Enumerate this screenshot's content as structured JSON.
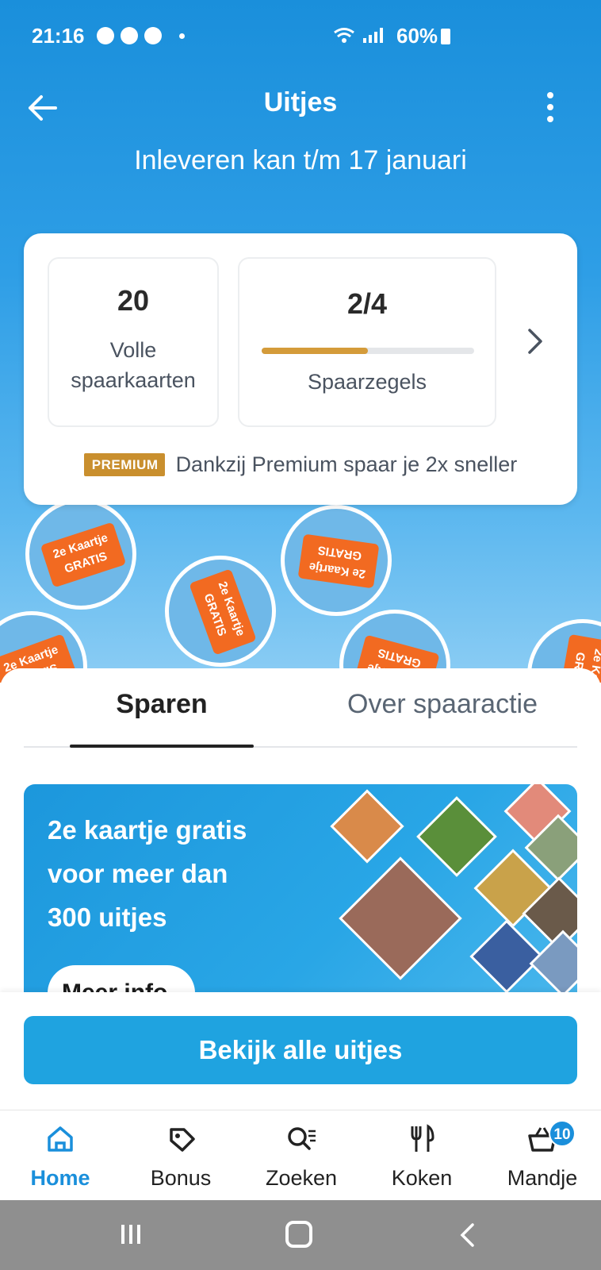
{
  "status_bar": {
    "time": "21:16",
    "battery": "60%"
  },
  "header": {
    "title": "Uitjes",
    "subtitle": "Inleveren kan t/m 17 januari"
  },
  "summary": {
    "full_cards_count": "20",
    "full_cards_label_line1": "Volle",
    "full_cards_label_line2": "spaarkaarten",
    "stamps_count": "2/4",
    "stamps_progress": 0.5,
    "stamps_label": "Spaarzegels",
    "premium_badge": "PREMIUM",
    "premium_text": "Dankzij Premium spaar je 2x sneller"
  },
  "stamps_art": {
    "ticket_text_line1": "2e Kaartje",
    "ticket_text_line2": "GRATIS"
  },
  "tabs": {
    "active": "Sparen",
    "inactive": "Over spaaractie"
  },
  "promo": {
    "line1": "2e kaartje gratis",
    "line2": "voor meer dan",
    "line3": "300 uitjes",
    "button": "Meer info"
  },
  "cta": {
    "label": "Bekijk alle uitjes"
  },
  "bottom_nav": {
    "items": [
      {
        "label": "Home",
        "icon": "home-icon"
      },
      {
        "label": "Bonus",
        "icon": "tag-icon"
      },
      {
        "label": "Zoeken",
        "icon": "search-list-icon"
      },
      {
        "label": "Koken",
        "icon": "cutlery-icon"
      },
      {
        "label": "Mandje",
        "icon": "basket-icon"
      }
    ],
    "basket_badge": "10"
  },
  "colors": {
    "brand": "#1a8fdb",
    "premium": "#c98f2e",
    "cta": "#1fa3e0",
    "ticket": "#f26a21"
  }
}
